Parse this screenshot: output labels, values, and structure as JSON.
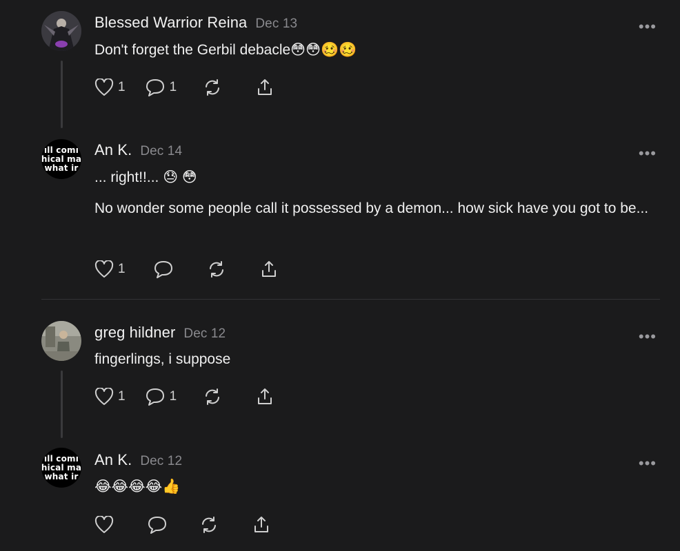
{
  "comments": [
    {
      "author": "Blessed Warrior Reina",
      "date": "Dec 13",
      "text": "Don't forget the Gerbil debacle😳😳🥴🥴",
      "likes": "1",
      "replies": "1",
      "avatar_icon": "warrior-portrait-avatar"
    },
    {
      "author": "An K.",
      "date": "Dec 14",
      "text": "... right!!... 😓 😳",
      "text2": "No wonder some people call it possessed by a demon... how sick have you got to be...",
      "likes": "1",
      "avatar_lines": [
        "ıll comı",
        "hical ma",
        "what ir"
      ]
    },
    {
      "author": "greg hildner",
      "date": "Dec 12",
      "text": "fingerlings, i suppose",
      "likes": "1",
      "replies": "1",
      "avatar_icon": "person-photo-avatar"
    },
    {
      "author": "An K.",
      "date": "Dec 12",
      "text": "😂😂😂😂👍",
      "avatar_lines": [
        "ıll comı",
        "hical ma",
        "what ir"
      ]
    }
  ],
  "more_label": "•••",
  "colors": {
    "background": "#1b1b1c",
    "text": "#f0f0f0",
    "muted": "#8a8a8e",
    "thread": "#3a3a3c"
  }
}
